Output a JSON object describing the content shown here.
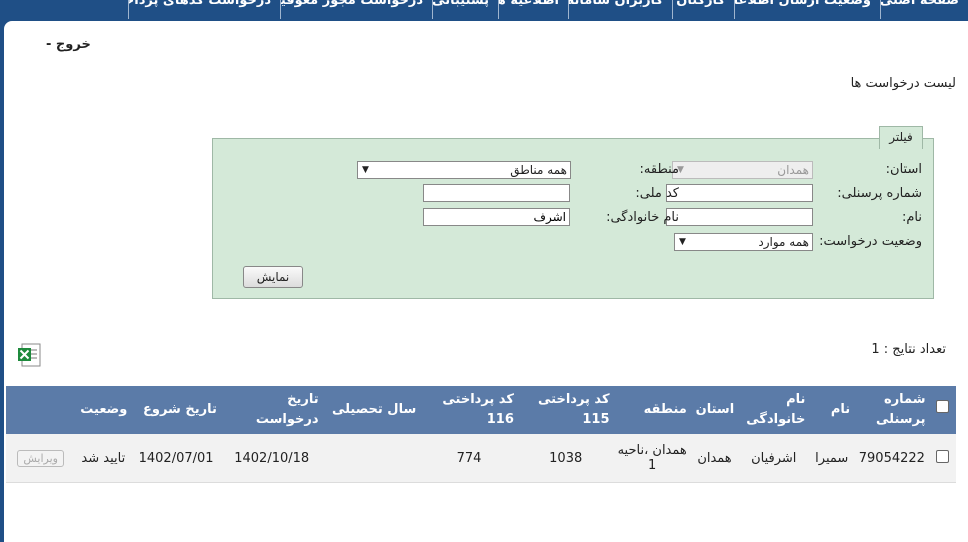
{
  "nav": {
    "tabs": [
      "صفحه اصلی",
      "وضعیت ارسال اطلاعات",
      "کارکنان",
      "کاربران سامانه",
      "اطلاعیه ها",
      "پشتیبانی",
      "درخواست مجوز معوقین",
      "درخواست کدهای پرداختی"
    ]
  },
  "header": {
    "logout": "خروج -"
  },
  "page": {
    "title": "لیست درخواست ها"
  },
  "filter": {
    "tab_label": "فیلتر",
    "province_label": "استان:",
    "province_value": "همدان",
    "region_label": "منطقه:",
    "region_value": "همه مناطق",
    "personnel_label": "شماره پرسنلی:",
    "personnel_value": "",
    "national_label": "کد ملی:",
    "national_value": "",
    "name_label": "نام:",
    "name_value": "",
    "family_label": "نام خانوادگی:",
    "family_value": "اشرف",
    "status_label": "وضعیت درخواست:",
    "status_value": "همه موارد",
    "show_button": "نمایش"
  },
  "results": {
    "count_text": "تعداد نتایج : 1"
  },
  "table": {
    "headers": [
      "شماره پرسنلی",
      "نام",
      "نام خانوادگی",
      "استان",
      "منطقه",
      "کد پرداختی 115",
      "کد پرداختی 116",
      "سال تحصیلی",
      "تاریخ درخواست",
      "تاریخ شروع",
      "وضعیت"
    ],
    "rows": [
      {
        "personnel": "79054222",
        "name": "سمیرا",
        "family": "اشرفیان",
        "province": "همدان",
        "region": "همدان ،ناحیه 1",
        "code115": "1038",
        "code116": "774",
        "year": "",
        "request_date": "1402/10/18",
        "start_date": "1402/07/01",
        "status": "تایید شد",
        "edit": "ویرایش"
      }
    ]
  },
  "colors": {
    "nav": "#1f4f86",
    "filter_bg": "#d4e9d8",
    "table_header": "#5b7ba8"
  }
}
